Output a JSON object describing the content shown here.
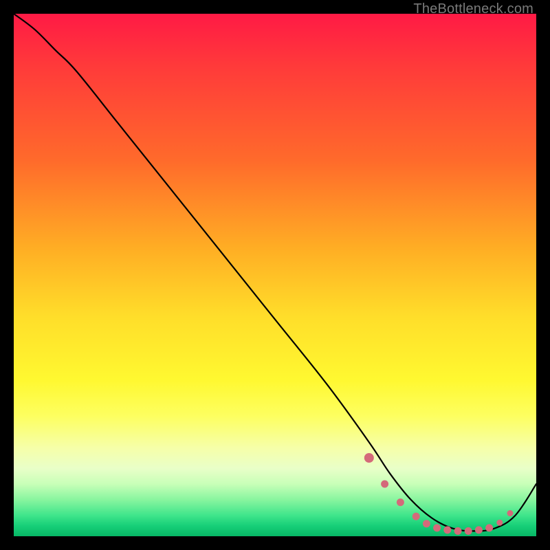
{
  "attribution": "TheBottleneck.com",
  "chart_data": {
    "type": "line",
    "title": "",
    "xlabel": "",
    "ylabel": "",
    "xlim": [
      0,
      100
    ],
    "ylim": [
      0,
      100
    ],
    "grid": false,
    "legend": false,
    "series": [
      {
        "name": "curve",
        "x": [
          0,
          4,
          8,
          12,
          20,
          30,
          40,
          50,
          60,
          68,
          72,
          76,
          80,
          84,
          88,
          92,
          96,
          100
        ],
        "y": [
          100,
          97,
          93,
          89,
          79,
          66.5,
          54,
          41.5,
          29,
          18,
          12,
          7,
          3.5,
          1.5,
          1,
          1.5,
          4,
          10
        ]
      }
    ],
    "markers": {
      "name": "highlight-dots",
      "color": "#d46a7a",
      "x": [
        68,
        71,
        74,
        77,
        79,
        81,
        83,
        85,
        87,
        89,
        91,
        93,
        95
      ],
      "y": [
        15,
        10,
        6.5,
        3.8,
        2.4,
        1.6,
        1.2,
        1.0,
        1.0,
        1.2,
        1.6,
        2.6,
        4.4
      ],
      "radius": [
        7,
        5.5,
        5.5,
        5.5,
        5.5,
        5.5,
        5.5,
        5.5,
        5.5,
        5.5,
        5.5,
        4.5,
        4.5
      ]
    }
  }
}
